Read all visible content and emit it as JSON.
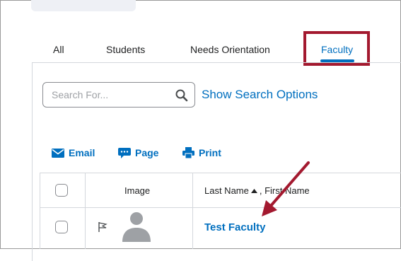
{
  "tabs": [
    {
      "label": "All"
    },
    {
      "label": "Students"
    },
    {
      "label": "Needs Orientation"
    },
    {
      "label": "Faculty",
      "active": true
    }
  ],
  "search": {
    "placeholder": "Search For...",
    "options_label": "Show Search Options"
  },
  "actions": [
    {
      "label": "Email",
      "icon": "envelope-icon"
    },
    {
      "label": "Page",
      "icon": "chat-bubble-icon"
    },
    {
      "label": "Print",
      "icon": "printer-icon"
    }
  ],
  "table": {
    "headers": {
      "image": "Image",
      "last_name": "Last Name",
      "first_name": ", First Name"
    },
    "rows": [
      {
        "name": "Test Faculty"
      }
    ]
  },
  "colors": {
    "accent": "#006fbf",
    "highlight": "#a3192f"
  }
}
